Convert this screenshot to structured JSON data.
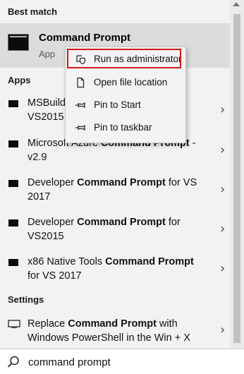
{
  "sections": {
    "best_match": "Best match",
    "apps": "Apps",
    "settings": "Settings"
  },
  "best_match": {
    "title": "Command Prompt",
    "subtitle": "App"
  },
  "apps": [
    {
      "pre": "MSBuild",
      "bold": "",
      "post": "",
      "line2": "VS2015"
    },
    {
      "pre": "Microsoft Azure ",
      "bold": "Command Prompt",
      "post": " -",
      "line2": "v2.9"
    },
    {
      "pre": "Developer ",
      "bold": "Command Prompt",
      "post": " for VS",
      "line2": "2017"
    },
    {
      "pre": "Developer ",
      "bold": "Command Prompt",
      "post": " for",
      "line2": "VS2015"
    },
    {
      "pre": "x86 Native Tools ",
      "bold": "Command Prompt",
      "post": "",
      "line2": "for VS 2017"
    }
  ],
  "settings_item": {
    "pre": "Replace ",
    "bold": "Command Prompt",
    "post": " with",
    "line2": "Windows PowerShell in the Win + X"
  },
  "context_menu": [
    {
      "label": "Run as administrator",
      "icon": "shield-icon"
    },
    {
      "label": "Open file location",
      "icon": "file-icon"
    },
    {
      "label": "Pin to Start",
      "icon": "pin-icon"
    },
    {
      "label": "Pin to taskbar",
      "icon": "pin-icon"
    }
  ],
  "search": {
    "value": "command prompt"
  },
  "colors": {
    "highlight_border": "#d11a1a",
    "selected_bg": "#dcdcdc",
    "panel_bg": "#f2f2f2"
  }
}
